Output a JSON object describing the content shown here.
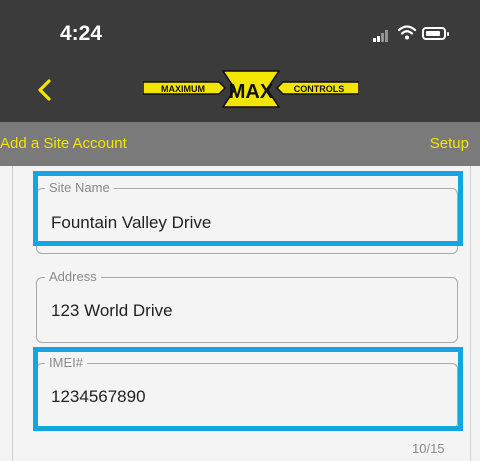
{
  "status_bar": {
    "time": "4:24",
    "icons": [
      "signal-icon",
      "wifi-icon",
      "battery-icon"
    ]
  },
  "nav": {
    "back_icon": "chevron-left-icon",
    "logo": {
      "left": "MAXIMUM",
      "center": "MAX",
      "right": "CONTROLS"
    }
  },
  "subheader": {
    "title": "Add a Site Account",
    "action": "Setup"
  },
  "form": {
    "site_name": {
      "label": "Site Name",
      "value": "Fountain Valley Drive"
    },
    "address": {
      "label": "Address",
      "value": "123 World Drive"
    },
    "imei": {
      "label": "IMEI#",
      "value": "1234567890",
      "counter": "10/15"
    }
  },
  "colors": {
    "bar_dark": "#3b3b3b",
    "bar_gray": "#7a7a7a",
    "accent_yellow": "#f2e500",
    "highlight_blue": "#13a6e1",
    "content_bg": "#f4f4f4"
  }
}
